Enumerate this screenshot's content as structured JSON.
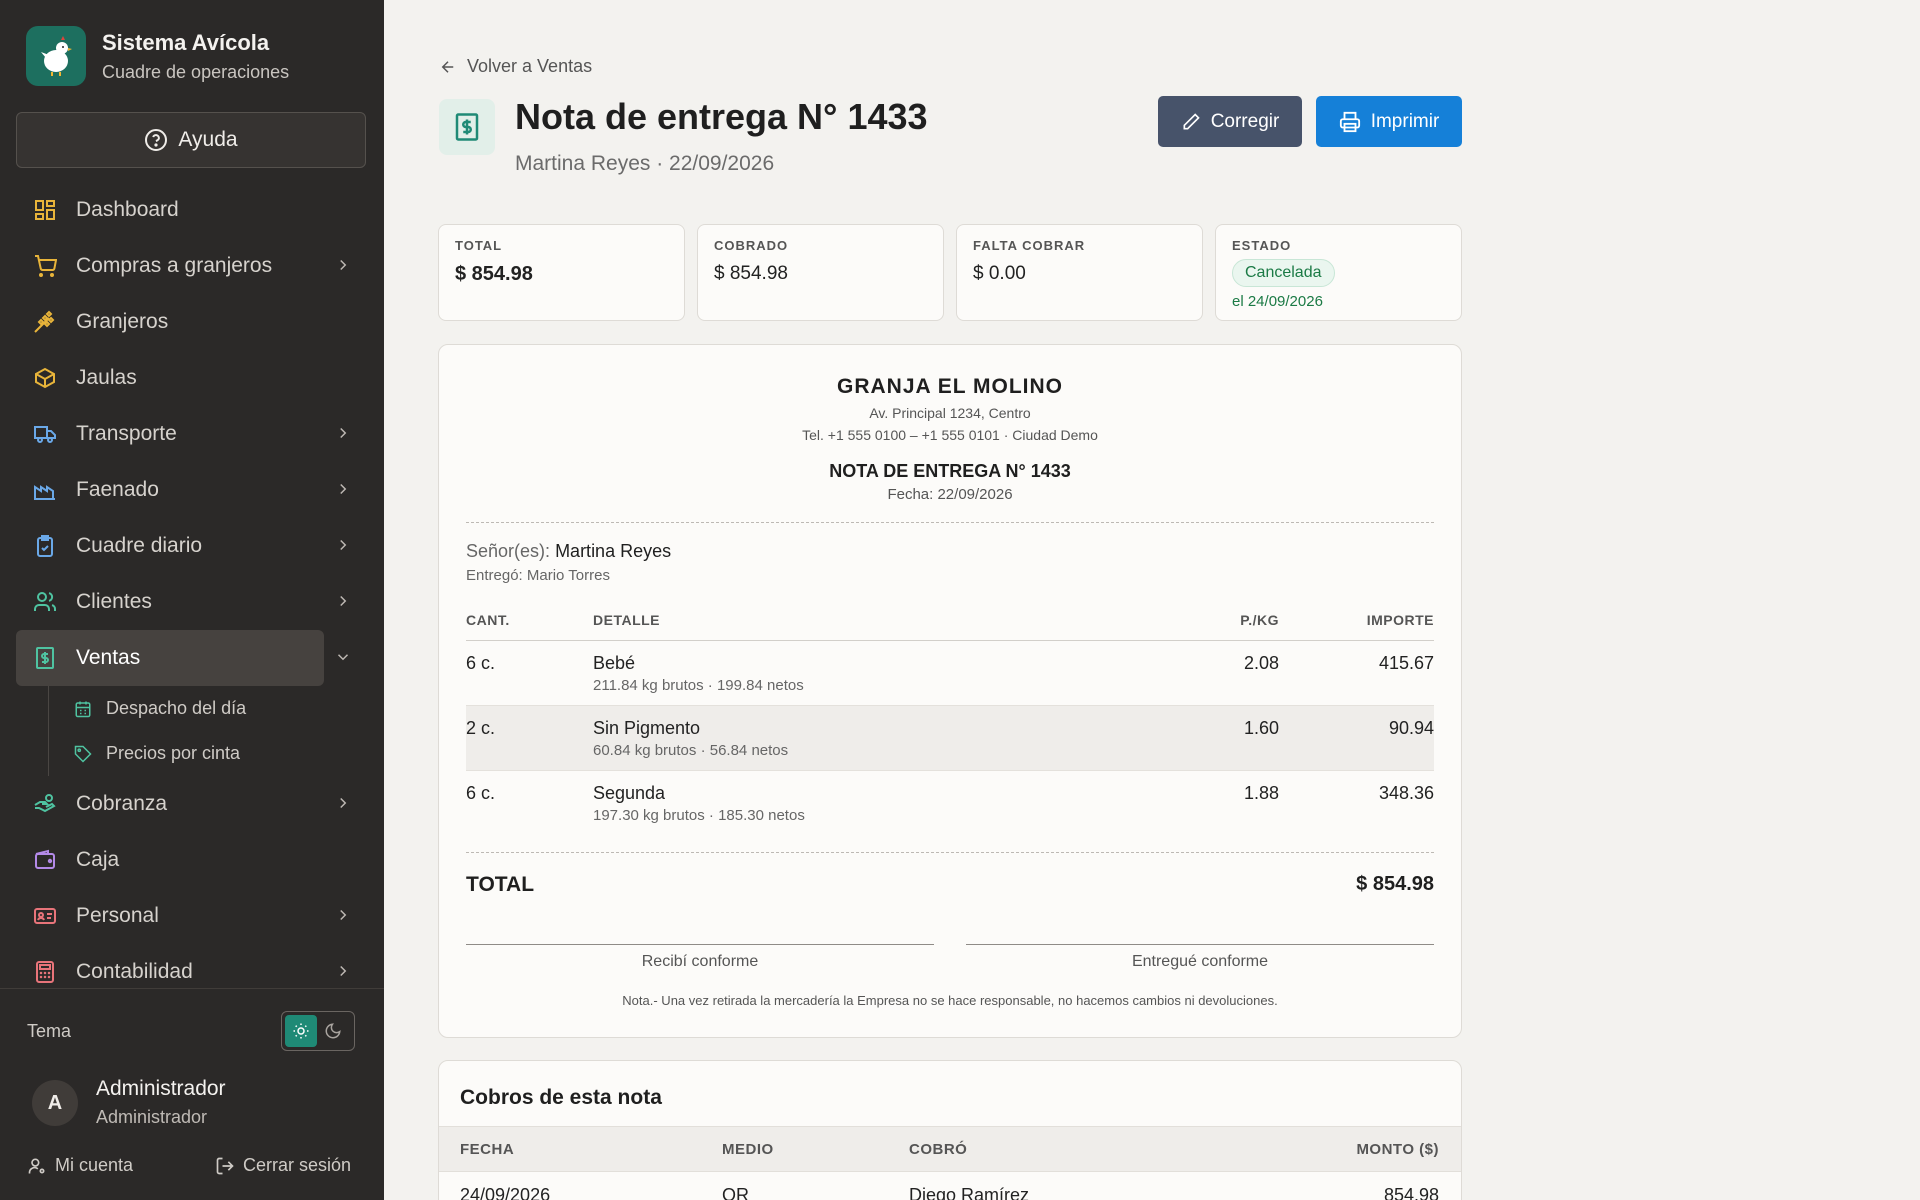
{
  "sidebar": {
    "brand_title": "Sistema Avícola",
    "brand_subtitle": "Cuadre de operaciones",
    "help_label": "Ayuda",
    "items": [
      {
        "label": "Dashboard",
        "icon": "grid-icon"
      },
      {
        "label": "Compras a granjeros",
        "icon": "cart-icon"
      },
      {
        "label": "Granjeros",
        "icon": "wheat-icon"
      },
      {
        "label": "Jaulas",
        "icon": "box-icon"
      },
      {
        "label": "Transporte",
        "icon": "truck-icon"
      },
      {
        "label": "Faenado",
        "icon": "factory-icon"
      },
      {
        "label": "Cuadre diario",
        "icon": "clipboard-check-icon"
      },
      {
        "label": "Clientes",
        "icon": "users-icon"
      },
      {
        "label": "Ventas",
        "icon": "receipt-icon"
      },
      {
        "label": "Cobranza",
        "icon": "hand-coins-icon"
      },
      {
        "label": "Caja",
        "icon": "wallet-icon"
      },
      {
        "label": "Personal",
        "icon": "id-card-icon"
      },
      {
        "label": "Contabilidad",
        "icon": "calculator-icon"
      }
    ],
    "sub_items": [
      {
        "label": "Despacho del día",
        "icon": "calendar-icon"
      },
      {
        "label": "Precios por cinta",
        "icon": "tag-icon"
      }
    ],
    "theme_label": "Tema",
    "user_initial": "A",
    "user_name": "Administrador",
    "user_role": "Administrador",
    "account_label": "Mi cuenta",
    "logout_label": "Cerrar sesión"
  },
  "header": {
    "back_label": "Volver a Ventas",
    "title": "Nota de entrega N° 1433",
    "subtitle": "Martina Reyes · 22/09/2026",
    "edit_label": "Corregir",
    "print_label": "Imprimir"
  },
  "stats": {
    "total_label": "TOTAL",
    "total_value": "$ 854.98",
    "cobrado_label": "COBRADO",
    "cobrado_value": "$ 854.98",
    "falta_label": "FALTA COBRAR",
    "falta_value": "$ 0.00",
    "estado_label": "ESTADO",
    "estado_badge": "Cancelada",
    "estado_date": "el 24/09/2026"
  },
  "document": {
    "company": "GRANJA EL MOLINO",
    "address": "Av. Principal 1234, Centro",
    "phone": "Tel. +1 555 0100 – +1 555 0101 · Ciudad Demo",
    "title": "NOTA DE ENTREGA N° 1433",
    "date": "Fecha: 22/09/2026",
    "customer_label": "Señor(es):",
    "customer": "Martina Reyes",
    "delivered_by": "Entregó: Mario Torres",
    "columns": {
      "qty": "CANT.",
      "detail": "DETALLE",
      "price": "P./KG",
      "amount": "IMPORTE"
    },
    "rows": [
      {
        "qty": "6 c.",
        "detail": "Bebé",
        "weights": "211.84 kg brutos · 199.84 netos",
        "price": "2.08",
        "amount": "415.67"
      },
      {
        "qty": "2 c.",
        "detail": "Sin Pigmento",
        "weights": "60.84 kg brutos · 56.84 netos",
        "price": "1.60",
        "amount": "90.94"
      },
      {
        "qty": "6 c.",
        "detail": "Segunda",
        "weights": "197.30 kg brutos · 185.30 netos",
        "price": "1.88",
        "amount": "348.36"
      }
    ],
    "total_label": "TOTAL",
    "total_value": "$ 854.98",
    "sign_received": "Recibí conforme",
    "sign_delivered": "Entregué conforme",
    "note": "Nota.- Una vez retirada la mercadería la Empresa no se hace responsable, no hacemos cambios ni devoluciones."
  },
  "cobros": {
    "title": "Cobros de esta nota",
    "columns": {
      "date": "FECHA",
      "method": "MEDIO",
      "collector": "COBRÓ",
      "amount": "MONTO ($)"
    },
    "rows": [
      {
        "date": "24/09/2026",
        "method": "QR",
        "collector": "Diego Ramírez",
        "amount": "854.98"
      }
    ]
  },
  "colors": {
    "sidebar_bg": "#2b2928",
    "accent_green": "#1f8a76",
    "print_blue": "#1580d8",
    "edit_slate": "#47536a"
  }
}
